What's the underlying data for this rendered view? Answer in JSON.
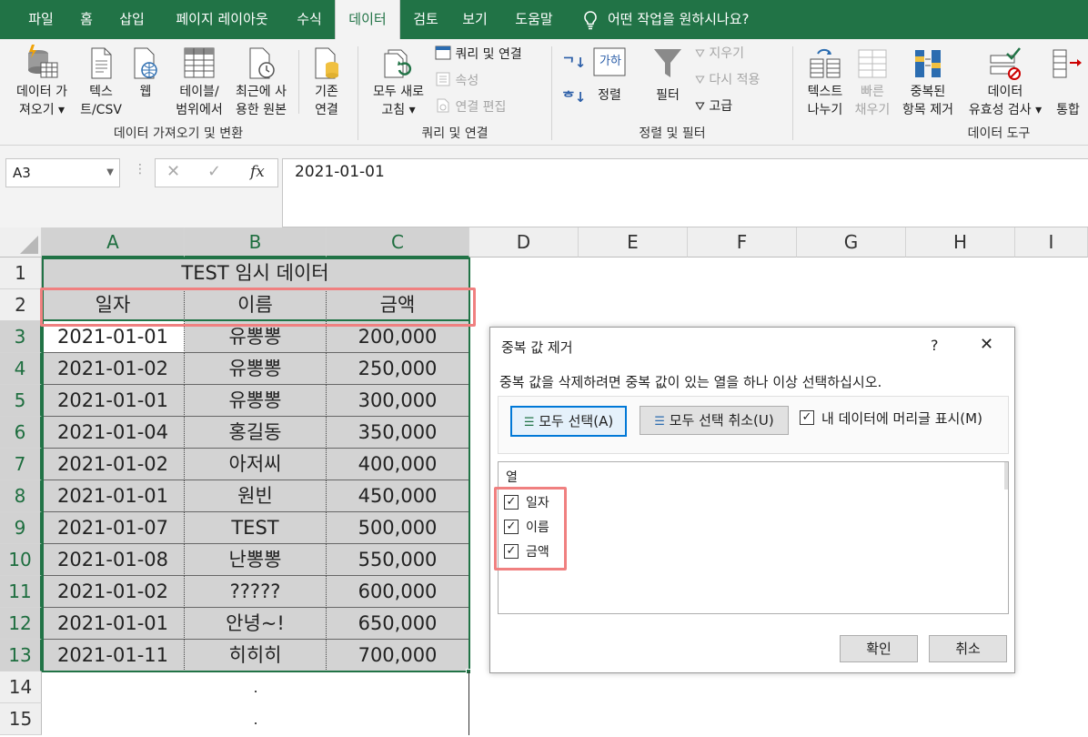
{
  "tabs": [
    "파일",
    "홈",
    "삽입",
    "페이지 레이아웃",
    "수식",
    "데이터",
    "검토",
    "보기",
    "도움말"
  ],
  "tell_me": "어떤 작업을 원하시나요?",
  "ribbon": {
    "get_data": [
      "데이터 가",
      "져오기"
    ],
    "text_csv": [
      "텍스",
      "트/CSV"
    ],
    "web": "웹",
    "from_table": [
      "테이블/",
      "범위에서"
    ],
    "recent_sources": [
      "최근에 사",
      "용한 원본"
    ],
    "existing": [
      "기존",
      "연결"
    ],
    "group_get": "데이터 가져오기 및 변환",
    "refresh_all": [
      "모두 새로",
      "고침"
    ],
    "queries_connections": "쿼리 및 연결",
    "properties": "속성",
    "edit_links": "연결 편집",
    "group_queries": "쿼리 및 연결",
    "sort": "정렬",
    "filter": "필터",
    "clear": "지우기",
    "reapply": "다시 적용",
    "advanced": "고급",
    "group_sort": "정렬 및 필터",
    "text_to_columns": [
      "텍스트",
      "나누기"
    ],
    "flash_fill": [
      "빠른",
      "채우기"
    ],
    "remove_duplicates": [
      "중복된",
      "항목 제거"
    ],
    "data_validation": [
      "데이터",
      "유효성 검사"
    ],
    "consolidate": "통합",
    "group_tools": "데이터 도구",
    "sort_sym": "정렬 기호"
  },
  "formula_bar": {
    "name_box": "A3",
    "fx": "fx",
    "value": "2021-01-01"
  },
  "columns": [
    "A",
    "B",
    "C",
    "D",
    "E",
    "F",
    "G",
    "H",
    "I"
  ],
  "rows": [
    "1",
    "2",
    "3",
    "4",
    "5",
    "6",
    "7",
    "8",
    "9",
    "10",
    "11",
    "12",
    "13",
    "14",
    "15"
  ],
  "sheet": {
    "title": "TEST 임시 데이터",
    "headers": [
      "일자",
      "이름",
      "금액"
    ],
    "data": [
      [
        "2021-01-01",
        "유뽕뽕",
        "200,000"
      ],
      [
        "2021-01-02",
        "유뽕뽕",
        "250,000"
      ],
      [
        "2021-01-01",
        "유뽕뽕",
        "300,000"
      ],
      [
        "2021-01-04",
        "홍길동",
        "350,000"
      ],
      [
        "2021-01-02",
        "아저씨",
        "400,000"
      ],
      [
        "2021-01-01",
        "원빈",
        "450,000"
      ],
      [
        "2021-01-07",
        "TEST",
        "500,000"
      ],
      [
        "2021-01-08",
        "난뽕뽕",
        "550,000"
      ],
      [
        "2021-01-02",
        "?????",
        "600,000"
      ],
      [
        "2021-01-01",
        "안녕~!",
        "650,000"
      ],
      [
        "2021-01-11",
        "히히히",
        "700,000"
      ]
    ],
    "extra": [
      ".",
      "."
    ]
  },
  "dialog": {
    "title": "중복 값 제거",
    "help": "?",
    "close": "✕",
    "instruction": "중복 값을 삭제하려면 중복 값이 있는 열을 하나 이상 선택하십시오.",
    "select_all": "모두 선택(A)",
    "unselect_all": "모두 선택 취소(U)",
    "has_headers": "내 데이터에 머리글 표시(M)",
    "list_header": "열",
    "columns": [
      "일자",
      "이름",
      "금액"
    ],
    "ok": "확인",
    "cancel": "취소"
  },
  "colors": {
    "excel_green": "#217346",
    "highlight": "#f08080",
    "selection": "#d3d3d3"
  }
}
